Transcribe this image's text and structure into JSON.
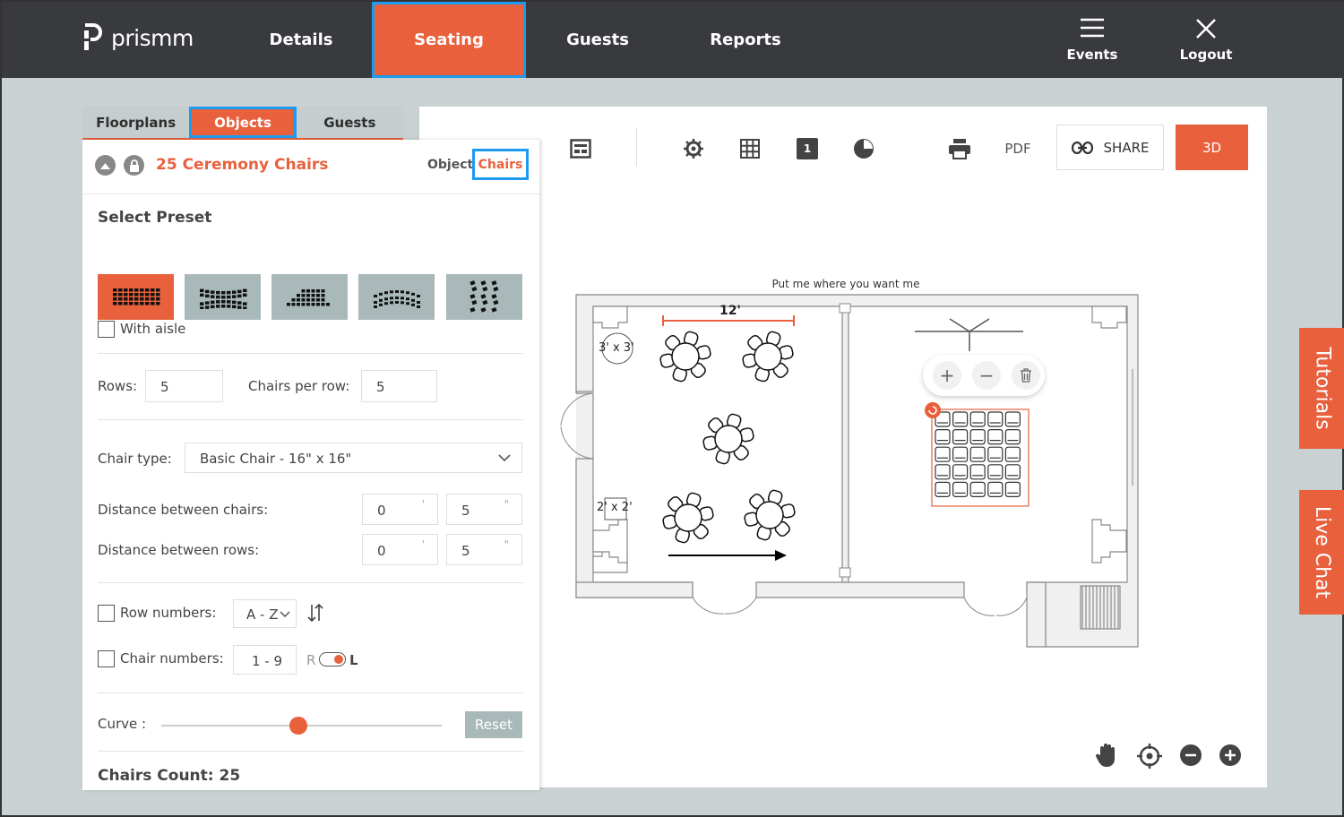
{
  "app": {
    "name": "prismm"
  },
  "nav": {
    "details": "Details",
    "seating": "Seating",
    "guests": "Guests",
    "reports": "Reports",
    "events": "Events",
    "logout": "Logout"
  },
  "panel": {
    "tabs": {
      "floorplans": "Floorplans",
      "objects": "Objects",
      "guests": "Guests"
    },
    "title": "25 Ceremony Chairs",
    "toggle_object": "Object",
    "toggle_chairs": "Chairs",
    "select_preset": "Select Preset",
    "with_aisle": "With aisle",
    "rows_label": "Rows:",
    "rows_value": "5",
    "chairs_per_row_label": "Chairs per row:",
    "chairs_per_row_value": "5",
    "chair_type_label": "Chair type:",
    "chair_type_value": "Basic Chair - 16\" x 16\"",
    "dist_chairs_label": "Distance between chairs:",
    "dist_chairs_ft": "0",
    "dist_chairs_in": "5",
    "dist_rows_label": "Distance between rows:",
    "dist_rows_ft": "0",
    "dist_rows_in": "5",
    "feet_mark": "'",
    "inch_mark": "\"",
    "row_numbers_label": "Row numbers:",
    "row_numbers_value": "A - Z",
    "chair_numbers_label": "Chair numbers:",
    "chair_numbers_value": "1 - 9",
    "dir_r": "R",
    "dir_l": "L",
    "curve_label": "Curve :",
    "curve_value": 0.49,
    "reset": "Reset",
    "chairs_count": "Chairs Count: 25"
  },
  "toolbar": {
    "pdf": "PDF",
    "share": "SHARE",
    "three_d": "3D",
    "layer_badge": "1"
  },
  "floorplan": {
    "hint": "Put me where you want me",
    "dimension": "12'",
    "table_3x3": "3' x 3'",
    "table_2x2": "2' x 2'"
  },
  "side": {
    "tutorials": "Tutorials",
    "live_chat": "Live Chat"
  },
  "colors": {
    "accent": "#e8603c",
    "topbar": "#383a3e",
    "highlight": "#1d9bf0",
    "background": "#c9d1d2"
  }
}
